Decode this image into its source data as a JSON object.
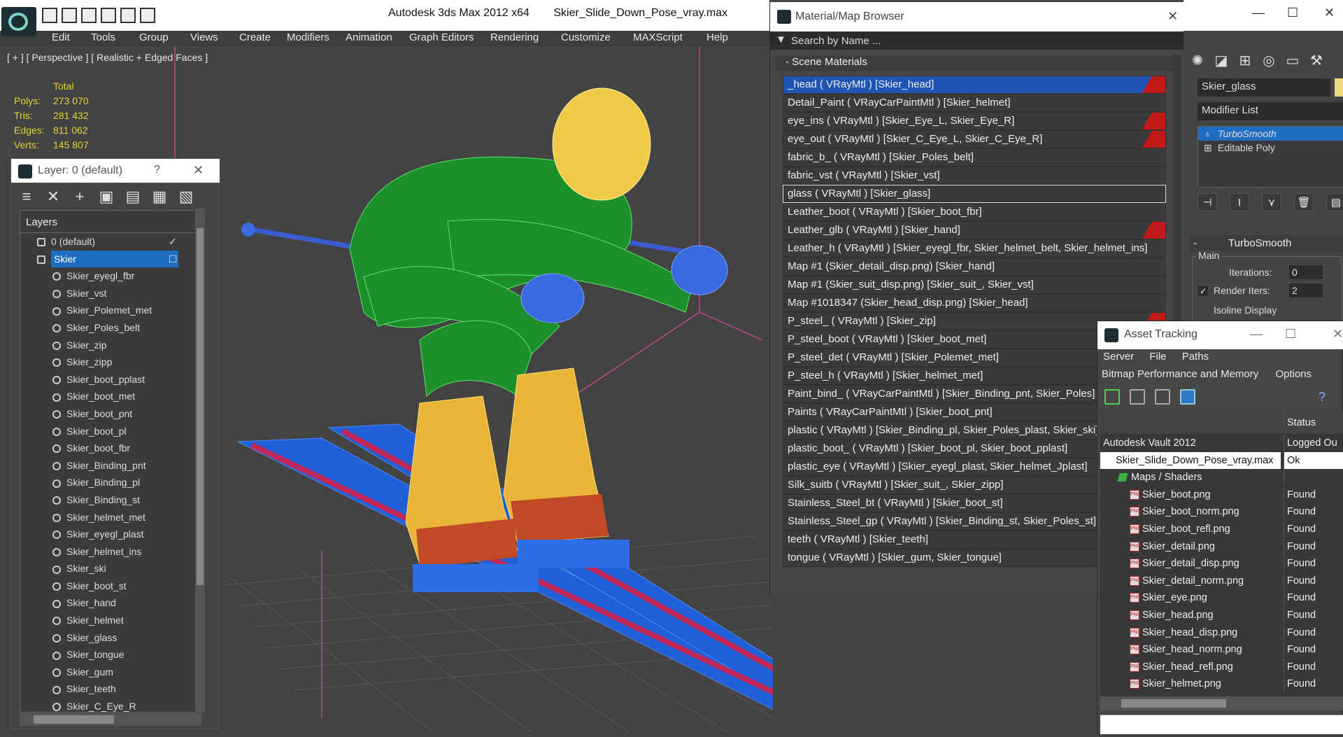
{
  "window": {
    "title": "Autodesk 3ds Max  2012 x64",
    "file": "Skier_Slide_Down_Pose_vray.max"
  },
  "menu": [
    "Edit",
    "Tools",
    "Group",
    "Views",
    "Create",
    "Modifiers",
    "Animation",
    "Graph Editors",
    "Rendering",
    "Customize",
    "MAXScript",
    "Help"
  ],
  "viewport": {
    "label": "[ + ] [ Perspective ] [ Realistic + Edged Faces ]",
    "stats": {
      "header": "Total",
      "rows": [
        {
          "label": "Polys:",
          "value": "273 070"
        },
        {
          "label": "Tris:",
          "value": "281 432"
        },
        {
          "label": "Edges:",
          "value": "811 062"
        },
        {
          "label": "Verts:",
          "value": "145 807"
        }
      ]
    }
  },
  "layer_panel": {
    "title": "Layer: 0 (default)",
    "help": "?",
    "close": "✕",
    "header": "Layers",
    "layers": [
      {
        "name": "0 (default)",
        "check": "✓"
      },
      {
        "name": "Skier",
        "selected": true,
        "check": "☐"
      }
    ],
    "objects": [
      "Skier_eyegl_fbr",
      "Skier_vst",
      "Skier_Polemet_met",
      "Skier_Poles_belt",
      "Skier_zip",
      "Skier_zipp",
      "Skier_boot_pplast",
      "Skier_boot_met",
      "Skier_boot_pnt",
      "Skier_boot_pl",
      "Skier_boot_fbr",
      "Skier_Binding_pnt",
      "Skier_Binding_pl",
      "Skier_Binding_st",
      "Skier_helmet_met",
      "Skier_eyegl_plast",
      "Skier_helmet_ins",
      "Skier_ski",
      "Skier_boot_st",
      "Skier_hand",
      "Skier_helmet",
      "Skier_glass",
      "Skier_tongue",
      "Skier_gum",
      "Skier_teeth",
      "Skier_C_Eye_R"
    ],
    "tools": [
      "≡",
      "✕",
      "+",
      "▣",
      "▤",
      "▦",
      "▧"
    ]
  },
  "material_browser": {
    "title": "Material/Map Browser",
    "search_placeholder": "Search by Name ...",
    "section": "- Scene Materials",
    "materials": [
      {
        "text": "_head  ( VRayMtl ) [Skier_head]",
        "selected": true,
        "flag": true
      },
      {
        "text": "Detail_Paint  ( VRayCarPaintMtl ) [Skier_helmet]"
      },
      {
        "text": "eye_ins  ( VRayMtl ) [Skier_Eye_L, Skier_Eye_R]",
        "flag": true
      },
      {
        "text": "eye_out  ( VRayMtl ) [Skier_C_Eye_L, Skier_C_Eye_R]",
        "flag": true
      },
      {
        "text": "fabric_b_  ( VRayMtl ) [Skier_Poles_belt]"
      },
      {
        "text": "fabric_vst  ( VRayMtl ) [Skier_vst]"
      },
      {
        "text": "glass  ( VRayMtl ) [Skier_glass]",
        "box": true
      },
      {
        "text": "Leather_boot  ( VRayMtl ) [Skier_boot_fbr]"
      },
      {
        "text": "Leather_glb  ( VRayMtl ) [Skier_hand]",
        "flag": true
      },
      {
        "text": "Leather_h  ( VRayMtl ) [Skier_eyegl_fbr, Skier_helmet_belt, Skier_helmet_ins]"
      },
      {
        "text": "Map #1 (Skier_detail_disp.png) [Skier_hand]"
      },
      {
        "text": "Map #1 (Skier_suit_disp.png) [Skier_suit_, Skier_vst]"
      },
      {
        "text": "Map #1018347 (Skier_head_disp.png) [Skier_head]"
      },
      {
        "text": "P_steel_  ( VRayMtl ) [Skier_zip]",
        "flag": true
      },
      {
        "text": "P_steel_boot  ( VRayMtl ) [Skier_boot_met]"
      },
      {
        "text": "P_steel_det  ( VRayMtl ) [Skier_Polemet_met]"
      },
      {
        "text": "P_steel_h  ( VRayMtl ) [Skier_helmet_met]"
      },
      {
        "text": "Paint_bind_  ( VRayCarPaintMtl ) [Skier_Binding_pnt, Skier_Poles]"
      },
      {
        "text": "Paints  ( VRayCarPaintMtl ) [Skier_boot_pnt]"
      },
      {
        "text": "plastic  ( VRayMtl ) [Skier_Binding_pl, Skier_Poles_plast, Skier_ski]"
      },
      {
        "text": "plastic_boot_  ( VRayMtl ) [Skier_boot_pl, Skier_boot_pplast]"
      },
      {
        "text": "plastic_eye  ( VRayMtl ) [Skier_eyegl_plast, Skier_helmet_Jplast]"
      },
      {
        "text": "Silk_suitb  ( VRayMtl ) [Skier_suit_, Skier_zipp]"
      },
      {
        "text": "Stainless_Steel_bt  ( VRayMtl ) [Skier_boot_st]"
      },
      {
        "text": "Stainless_Steel_gp  ( VRayMtl ) [Skier_Binding_st, Skier_Poles_st]"
      },
      {
        "text": "teeth  ( VRayMtl ) [Skier_teeth]"
      },
      {
        "text": "tongue  ( VRayMtl ) [Skier_gum, Skier_tongue]"
      }
    ]
  },
  "command_panel": {
    "object_name": "Skier_glass",
    "modifier_list": "Modifier List",
    "stack": [
      "TurboSmooth",
      "Editable Poly"
    ],
    "rollout": "TurboSmooth",
    "group": "Main",
    "iterations_label": "Iterations:",
    "iterations": "0",
    "render_iters_label": "Render Iters:",
    "render_iters": "2",
    "isoline": "Isoline Display",
    "object_color": "#f2d580"
  },
  "asset_tracking": {
    "title": "Asset Tracking",
    "menu": [
      "Server",
      "File",
      "Paths"
    ],
    "menu2": [
      "Bitmap Performance and Memory",
      "Options"
    ],
    "status_header": "Status",
    "rows": [
      {
        "name": "Autodesk Vault 2012",
        "status": "Logged Ou",
        "kind": "root"
      },
      {
        "name": "Skier_Slide_Down_Pose_vray.max",
        "status": "Ok",
        "kind": "file"
      },
      {
        "name": "Maps / Shaders",
        "status": "",
        "kind": "group"
      },
      {
        "name": "Skier_boot.png",
        "status": "Found",
        "kind": "item"
      },
      {
        "name": "Skier_boot_norm.png",
        "status": "Found",
        "kind": "item"
      },
      {
        "name": "Skier_boot_refl.png",
        "status": "Found",
        "kind": "item"
      },
      {
        "name": "Skier_detail.png",
        "status": "Found",
        "kind": "item"
      },
      {
        "name": "Skier_detail_disp.png",
        "status": "Found",
        "kind": "item"
      },
      {
        "name": "Skier_detail_norm.png",
        "status": "Found",
        "kind": "item"
      },
      {
        "name": "Skier_eye.png",
        "status": "Found",
        "kind": "item"
      },
      {
        "name": "Skier_head.png",
        "status": "Found",
        "kind": "item"
      },
      {
        "name": "Skier_head_disp.png",
        "status": "Found",
        "kind": "item"
      },
      {
        "name": "Skier_head_norm.png",
        "status": "Found",
        "kind": "item"
      },
      {
        "name": "Skier_head_refl.png",
        "status": "Found",
        "kind": "item"
      },
      {
        "name": "Skier_helmet.png",
        "status": "Found",
        "kind": "item"
      }
    ]
  }
}
